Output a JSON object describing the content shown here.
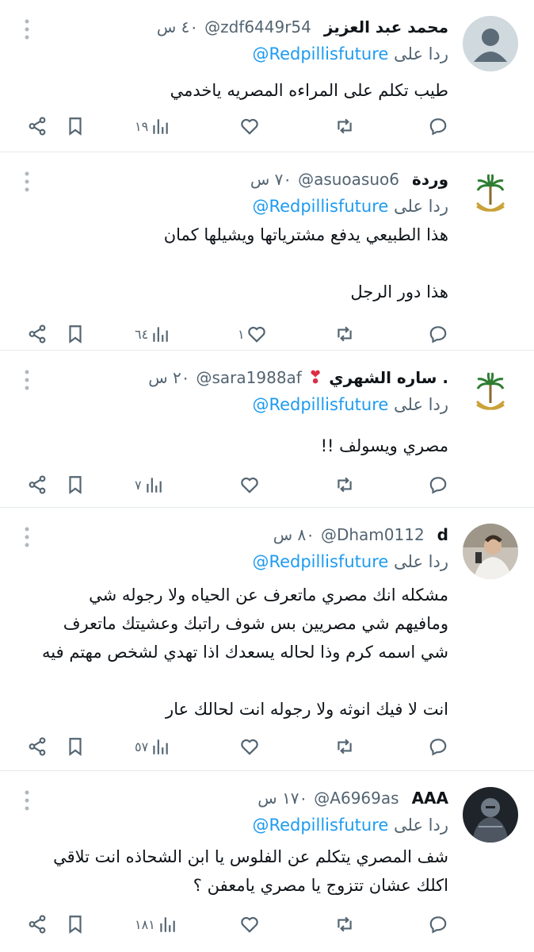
{
  "reply_prefix": "ردا على",
  "tweets": [
    {
      "name": "محمد عبد العزيز",
      "emoji": "",
      "handle": "@zdf6449r54",
      "time": "٤٠ س",
      "reply_to": "@Redpillisfuture",
      "avatar": "default-avatar",
      "lines": [
        "طيب تكلم على المراءه المصريه ياخدمي"
      ],
      "views": "١٩",
      "likes": "",
      "retweets": ""
    },
    {
      "name": "وردة",
      "emoji": "",
      "handle": "@asuoasuo6",
      "time": "٧٠ س",
      "reply_to": "@Redpillisfuture",
      "avatar": "saudi-emblem",
      "lines": [
        "هذا الطبيعي يدفع مشترياتها ويشيلها كمان",
        "",
        "هذا دور الرجل"
      ],
      "views": "٦٤",
      "likes": "١",
      "retweets": ""
    },
    {
      "name": "ساره الشهري .",
      "emoji": "❣",
      "handle": "@sara1988af",
      "time": "٢٠ س",
      "reply_to": "@Redpillisfuture",
      "avatar": "saudi-emblem",
      "lines": [
        "مصري ويسولف !!"
      ],
      "views": "٧",
      "likes": "",
      "retweets": ""
    },
    {
      "name": "d",
      "emoji": "",
      "handle": "@Dham0112",
      "time": "٨٠ س",
      "reply_to": "@Redpillisfuture",
      "avatar": "photo-person",
      "lines": [
        "مشكله انك مصري ماتعرف عن الحياه ولا رجوله شي",
        "ومافيهم شي مصريين بس شوف راتبك وعشيتك ماتعرف",
        "شي اسمه كرم وذا لحاله يسعدك اذا تهدي لشخص مهتم فيه",
        "",
        "انت لا فيك انوثه ولا رجوله انت لحالك عار"
      ],
      "views": "٥٧",
      "likes": "",
      "retweets": ""
    },
    {
      "name": "AAA",
      "emoji": "",
      "handle": "@A6969as",
      "time": "١٧٠ س",
      "reply_to": "@Redpillisfuture",
      "avatar": "photo-knight",
      "lines": [
        "شف المصري يتكلم عن الفلوس يا ابن الشحاذه انت تلاقي",
        "اكلك عشان تتزوج يا مصري يامعفن ؟"
      ],
      "views": "١٨١",
      "likes": "",
      "retweets": ""
    }
  ],
  "colors": {
    "text": "#0f1419",
    "muted": "#536471",
    "link": "#1d9bf0",
    "divider": "#e6e9ec",
    "emblem_green": "#2e7d32",
    "emblem_gold": "#c9a23a",
    "heart_red": "#dd2e44"
  }
}
